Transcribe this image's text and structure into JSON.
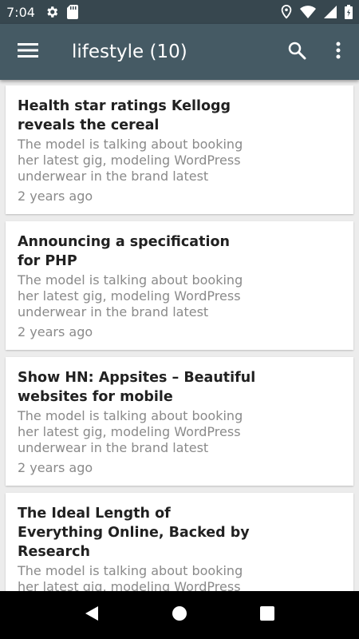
{
  "status_bar": {
    "time": "7:04",
    "left_icons": [
      "gear-icon",
      "sd-card-icon"
    ],
    "right_icons": [
      "location-icon",
      "wifi-icon",
      "cellular-icon",
      "battery-icon"
    ]
  },
  "app_bar": {
    "title": "lifestyle (10)",
    "menu_icon": "hamburger-menu-icon",
    "actions": [
      "search-icon",
      "more-vert-icon"
    ],
    "colors": {
      "app_bar": "#455a64",
      "status_bar": "#37474f"
    }
  },
  "articles": [
    {
      "title": "Health star ratings Kellogg reveals the cereal",
      "summary": "The model is talking about booking her latest gig, modeling WordPress underwear in the brand latest",
      "time": "2 years ago"
    },
    {
      "title": "Announcing a specification for PHP",
      "summary": "The model is talking about booking her latest gig, modeling WordPress underwear in the brand latest",
      "time": "2 years ago"
    },
    {
      "title": "Show HN: Appsites – Beautiful websites for mobile",
      "summary": "The model is talking about booking her latest gig, modeling WordPress underwear in the brand latest",
      "time": "2 years ago"
    },
    {
      "title": "The Ideal Length of Everything Online, Backed by Research",
      "summary": "The model is talking about booking her latest gig, modeling WordPress underwear in the brand latest",
      "time": ""
    }
  ],
  "nav_bar": {
    "buttons": [
      "back-icon",
      "home-icon",
      "recents-icon"
    ]
  }
}
